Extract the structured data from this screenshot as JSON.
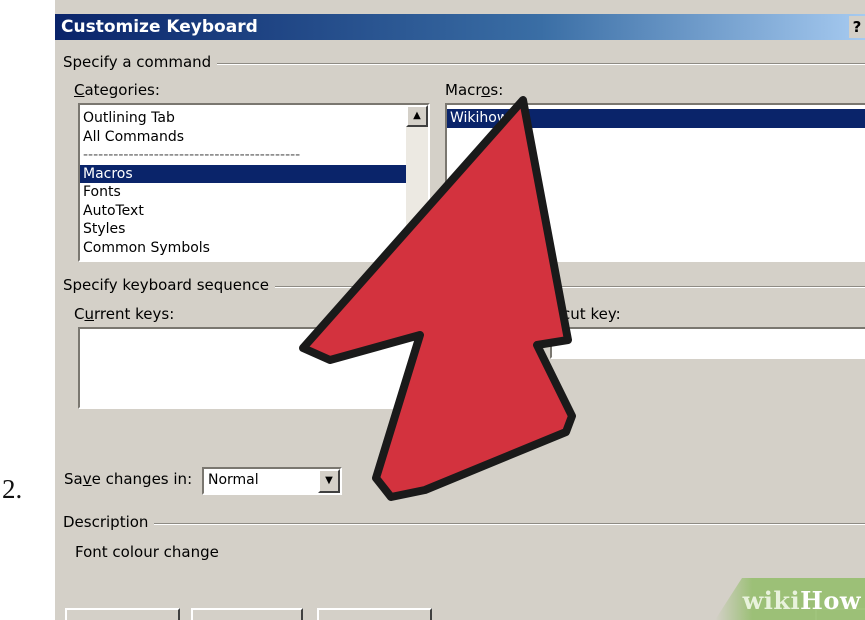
{
  "step_number": "2.",
  "dialog": {
    "title": "Customize Keyboard",
    "help_glyph": "?"
  },
  "specify_command": {
    "group_label": "Specify a command",
    "categories_label_accel": "C",
    "categories_label_rest": "ategories:",
    "categories": [
      {
        "label": "Outlining Tab",
        "selected": false
      },
      {
        "label": "All Commands",
        "selected": false
      },
      {
        "label": "-------------------------------------------",
        "selected": false
      },
      {
        "label": "Macros",
        "selected": true
      },
      {
        "label": "Fonts",
        "selected": false
      },
      {
        "label": "AutoText",
        "selected": false
      },
      {
        "label": "Styles",
        "selected": false
      },
      {
        "label": "Common Symbols",
        "selected": false
      }
    ],
    "macros_label_pre": "Macr",
    "macros_label_accel": "o",
    "macros_label_post": "s:",
    "macros": [
      {
        "label": "Wikihow",
        "selected": true
      }
    ]
  },
  "keyboard_sequence": {
    "group_label": "Specify keyboard sequence",
    "current_keys_label_pre": "C",
    "current_keys_label_accel": "u",
    "current_keys_label_post": "rrent keys:",
    "shortcut_label_partial": "rtcut key:"
  },
  "save_changes": {
    "label_pre": "Sa",
    "label_accel": "v",
    "label_post": "e changes in:",
    "value": "Normal"
  },
  "description": {
    "group_label": "Description",
    "text": "Font colour change"
  },
  "watermark": {
    "wiki": "wiki",
    "how": "How"
  },
  "colors": {
    "arrow_fill": "#d3323e",
    "arrow_outline": "#1a1a1a",
    "selection": "#0a246a",
    "dialog_bg": "#d4d0c8"
  }
}
